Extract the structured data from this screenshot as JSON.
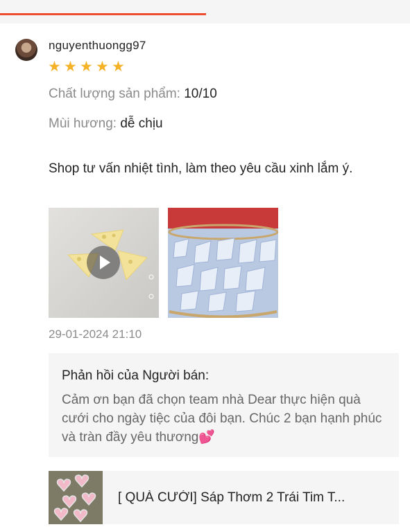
{
  "review": {
    "username": "nguyenthuongg97",
    "rating": 5,
    "attributes": [
      {
        "label": "Chất lượng sản phẩm:",
        "value": "10/10"
      },
      {
        "label": "Mùi hương:",
        "value": "dễ chịu"
      }
    ],
    "comment": "Shop tư vấn nhiệt tình, làm theo yêu cầu xinh lắm ý.",
    "timestamp": "29-01-2024 21:10"
  },
  "seller_reply": {
    "title": "Phản hồi của Người bán:",
    "body": "Cảm ơn bạn đã chọn team nhà Dear thực hiện quà cưới cho ngày tiệc của đôi bạn. Chúc 2 bạn hạnh phúc và tràn đầy yêu thương",
    "emoji": "💕"
  },
  "product": {
    "title": "[ QUÀ CƯỚI] Sáp Thơm 2 Trái Tim T..."
  },
  "icons": {
    "play": "play-icon",
    "star": "star-icon"
  },
  "colors": {
    "accent": "#ee4d2d",
    "star": "#f6b227",
    "muted_text": "#8a8a8a",
    "reply_bg": "#f5f5f5"
  }
}
